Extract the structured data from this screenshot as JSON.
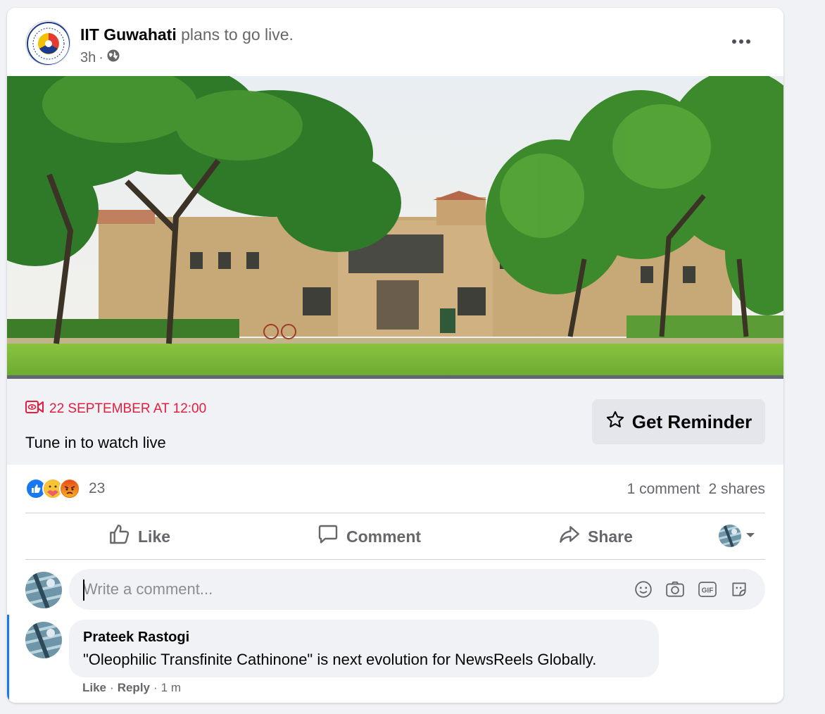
{
  "post": {
    "author": "IIT Guwahati",
    "action": " plans to go live.",
    "time": "3h",
    "separator": "·",
    "privacy_icon": "globe-icon"
  },
  "event": {
    "date": "22 SEPTEMBER AT 12:00",
    "subtitle": "Tune in to watch live",
    "reminder_label": "Get Reminder",
    "date_color": "#e41e3f"
  },
  "reactions": {
    "types": [
      "like",
      "care",
      "angry"
    ],
    "count": "23"
  },
  "stats": {
    "comments": "1 comment",
    "shares": "2 shares"
  },
  "actions": {
    "like": "Like",
    "comment": "Comment",
    "share": "Share"
  },
  "composer": {
    "placeholder": "Write a comment..."
  },
  "comment": {
    "author": "Prateek Rastogi",
    "text": "\"Oleophilic Transfinite Cathinone\" is next evolution for NewsReels Globally.",
    "like": "Like",
    "reply": "Reply",
    "time": "1 m",
    "dot": "·"
  },
  "colors": {
    "accent": "#1877f2",
    "secondary_text": "#65676b",
    "background": "#f0f2f5"
  }
}
